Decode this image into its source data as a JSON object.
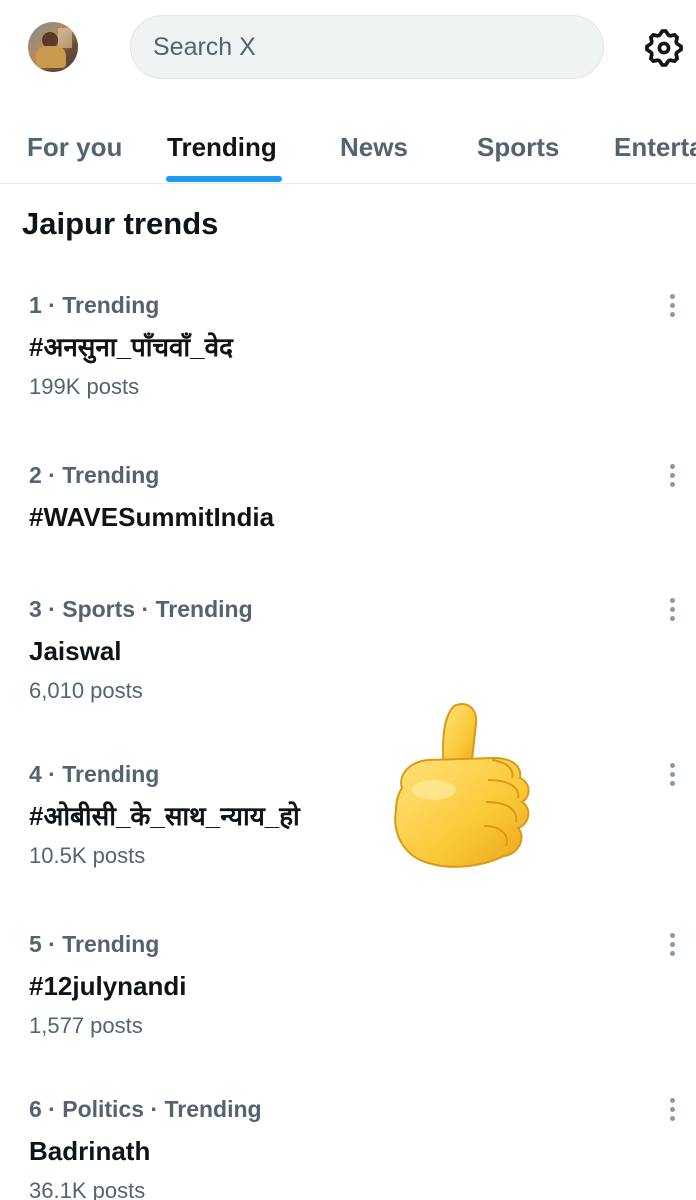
{
  "search": {
    "placeholder": "Search X"
  },
  "header": {
    "avatar_icon": "profile-avatar",
    "settings_icon": "gear-icon"
  },
  "tabs": [
    {
      "label": "For you"
    },
    {
      "label": "Trending"
    },
    {
      "label": "News"
    },
    {
      "label": "Sports"
    },
    {
      "label": "Entertainment"
    }
  ],
  "section": {
    "title": "Jaipur trends"
  },
  "trends": [
    {
      "meta": "1 · Trending",
      "name": "#अनसुना_पाँचवाँ_वेद",
      "posts": "199K posts"
    },
    {
      "meta": "2 · Trending",
      "name": "#WAVESummitIndia",
      "posts": ""
    },
    {
      "meta": "3 · Sports · Trending",
      "name": "Jaiswal",
      "posts": "6,010 posts"
    },
    {
      "meta": "4 · Trending",
      "name": "#ओबीसी_के_साथ_न्याय_हो",
      "posts": "10.5K posts"
    },
    {
      "meta": "5 · Trending",
      "name": "#12julynandi",
      "posts": "1,577 posts"
    },
    {
      "meta": "6 · Politics · Trending",
      "name": "Badrinath",
      "posts": "36.1K posts"
    }
  ],
  "overlay": {
    "emoji": "thumbs-up-icon"
  },
  "colors": {
    "accent": "#1d9bf0",
    "muted": "#536471",
    "text": "#0f1419"
  }
}
